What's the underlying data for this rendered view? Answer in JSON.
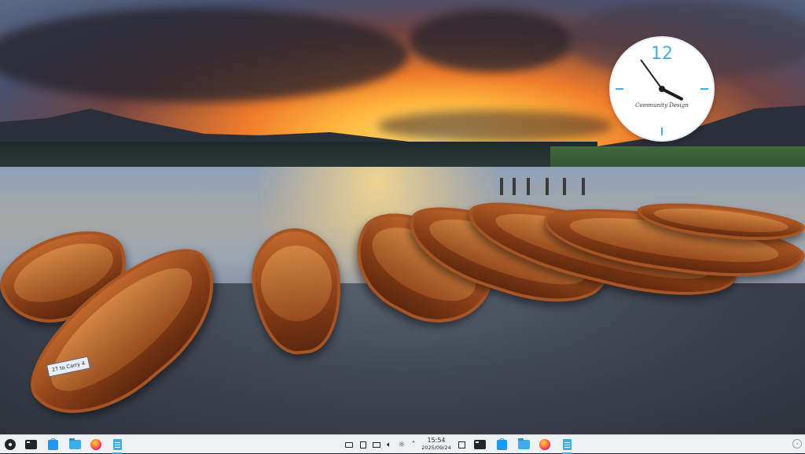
{
  "desktop": {
    "wallpaper": "sunset-lake-rowing-boats",
    "boat_label": "27 to Carry 4",
    "accent_color": "#3daee9"
  },
  "clock_widget": {
    "numeral": "12",
    "brand": "Community Design",
    "hour": 15,
    "minute": 54
  },
  "taskbar": {
    "launchers": [
      {
        "name": "application-launcher",
        "icon": "gear-icon"
      },
      {
        "name": "terminal",
        "icon": "terminal-icon"
      },
      {
        "name": "discover",
        "icon": "store-icon"
      },
      {
        "name": "file-manager",
        "icon": "folder-icon"
      },
      {
        "name": "firefox",
        "icon": "firefox-icon"
      },
      {
        "name": "text-editor",
        "icon": "document-icon"
      }
    ],
    "tray": [
      "keyboard-icon",
      "clipboard-icon",
      "display-icon",
      "volume-icon",
      "brightness-icon",
      "chevron-up-icon"
    ],
    "time": "15:54",
    "date": "2025/09/24",
    "right_tasks": [
      "show-desktop-icon",
      "terminal-icon",
      "store-icon",
      "folder-icon",
      "firefox-icon",
      "document-icon"
    ]
  }
}
